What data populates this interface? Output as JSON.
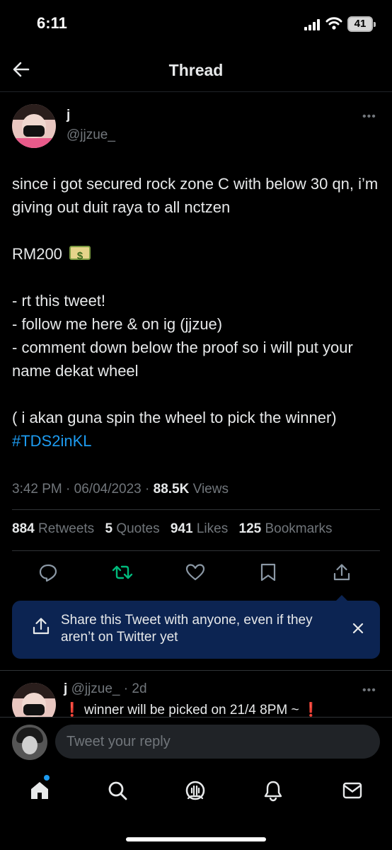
{
  "status_bar": {
    "time": "6:11",
    "battery": "41"
  },
  "nav": {
    "title": "Thread"
  },
  "tweet": {
    "author": {
      "name": "j",
      "handle": "@jjzue_"
    },
    "body": {
      "p1": "since i got secured rock zone C with below 30 qn, i’m giving out duit raya to all nctzen",
      "amount": "RM200",
      "emoji": "money-with-wings-emoji",
      "rules": [
        "- rt this tweet!",
        "- follow me here & on ig (jjzue)",
        "- comment down below the proof so i will put your name dekat wheel"
      ],
      "note": "( i akan guna spin the wheel to pick the winner)",
      "hashtag": "#TDS2inKL"
    },
    "meta": {
      "time": "3:42 PM",
      "sep": "·",
      "date": "06/04/2023",
      "views_count": "88.5K",
      "views_label": "Views"
    },
    "stats": [
      {
        "count": "884",
        "label": "Retweets"
      },
      {
        "count": "5",
        "label": "Quotes"
      },
      {
        "count": "941",
        "label": "Likes"
      },
      {
        "count": "125",
        "label": "Bookmarks"
      }
    ],
    "actions": [
      "reply-icon",
      "retweet-icon",
      "like-icon",
      "bookmark-icon",
      "share-icon"
    ],
    "retweet_color": "#00ba7c"
  },
  "share_tip": {
    "text": "Share this Tweet with anyone, even if they aren’t on Twitter yet"
  },
  "reply": {
    "name": "j",
    "handle": "@jjzue_",
    "sep": "·",
    "age": "2d",
    "excl": "❗",
    "text": "winner will be picked on 21/4 8PM ~"
  },
  "compose": {
    "placeholder": "Tweet your reply"
  },
  "tabs": [
    "home-icon",
    "search-icon",
    "spaces-icon",
    "notifications-icon",
    "messages-icon"
  ],
  "colors": {
    "accent": "#1d9bf0",
    "tip_bg": "#0c2452",
    "muted": "#71767b"
  }
}
